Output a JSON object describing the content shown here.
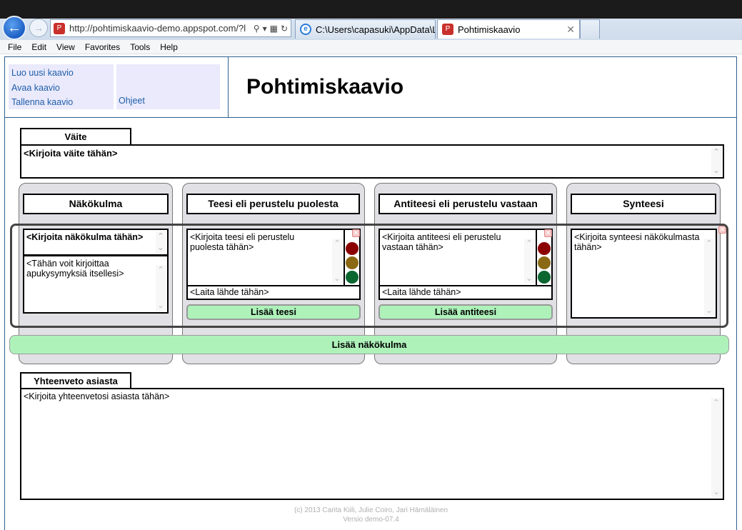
{
  "browser": {
    "url": "http://pohtimiskaavio-demo.appspot.com/?l",
    "tabs": [
      {
        "label": "C:\\Users\\capasuki\\AppData\\L..."
      },
      {
        "label": "Pohtimiskaavio"
      }
    ],
    "menu": [
      "File",
      "Edit",
      "View",
      "Favorites",
      "Tools",
      "Help"
    ]
  },
  "sidebar": {
    "links": [
      "Luo uusi kaavio",
      "Avaa kaavio",
      "Tallenna kaavio"
    ],
    "help_link": "Ohjeet"
  },
  "page_title": "Pohtimiskaavio",
  "claim": {
    "label": "Väite",
    "placeholder": "<Kirjoita väite tähän>"
  },
  "columns": {
    "perspective": "Näkökulma",
    "thesis": "Teesi eli perustelu puolesta",
    "antithesis": "Antiteesi eli perustelu vastaan",
    "synthesis": "Synteesi"
  },
  "perspective_box": {
    "title_placeholder": "<Kirjoita näkökulma tähän>",
    "notes_placeholder": "<Tähän voit kirjoittaa apukysymyksiä itsellesi>"
  },
  "thesis_box": {
    "placeholder": "<Kirjoita teesi eli perustelu puolesta tähän>",
    "source_placeholder": "<Laita lähde tähän>",
    "add_button": "Lisää teesi"
  },
  "antithesis_box": {
    "placeholder": "<Kirjoita antiteesi eli perustelu vastaan tähän>",
    "source_placeholder": "<Laita lähde tähän>",
    "add_button": "Lisää antiteesi"
  },
  "synthesis_box": {
    "placeholder": "<Kirjoita synteesi näkökulmasta tähän>"
  },
  "add_perspective_button": "Lisää näkökulma",
  "summary": {
    "label": "Yhteenveto asiasta",
    "placeholder": "<Kirjoita yhteenvetosi asiasta tähän>"
  },
  "footer": {
    "credits": "(c) 2013 Carita Kiili, Julie Coiro, Jari Hämäläinen",
    "version": "Versio demo-07.4"
  },
  "colors": {
    "light_red": "#8b0000",
    "light_yellow": "#8b6914",
    "light_green": "#0b6630",
    "button_green": "#aef2ba",
    "link_blue": "#1f5ea8",
    "panel_gray": "#e0e0e5"
  }
}
